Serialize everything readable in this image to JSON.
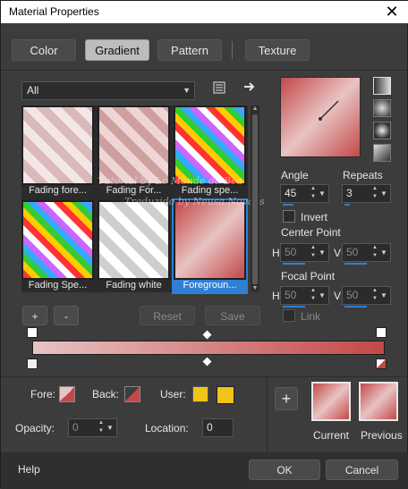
{
  "window": {
    "title": "Material Properties",
    "close_glyph": "✕"
  },
  "tabs": [
    {
      "label": "Color",
      "active": false
    },
    {
      "label": "Gradient",
      "active": true
    },
    {
      "label": "Pattern",
      "active": false
    },
    {
      "label": "Texture",
      "active": false
    }
  ],
  "filter": {
    "selected": "All"
  },
  "swatches": [
    {
      "label": "Fading fore...",
      "kind": "fading-pink-light"
    },
    {
      "label": "Fading For...",
      "kind": "fading-pink"
    },
    {
      "label": "Fading spe...",
      "kind": "rainbow"
    },
    {
      "label": "Fading Spe...",
      "kind": "rainbow"
    },
    {
      "label": "Fading white",
      "kind": "fading-white"
    },
    {
      "label": "Foregroun...",
      "kind": "fg-bg",
      "selected": true
    }
  ],
  "list_buttons": {
    "add": "+",
    "remove": "-",
    "reset": "Reset",
    "save": "Save"
  },
  "angle": {
    "label": "Angle",
    "value": "45"
  },
  "repeats": {
    "label": "Repeats",
    "value": "3"
  },
  "invert": {
    "label": "Invert",
    "checked": false
  },
  "center_point": {
    "label": "Center Point",
    "h_label": "H",
    "h_value": "50",
    "v_label": "V",
    "v_value": "50"
  },
  "focal_point": {
    "label": "Focal Point",
    "h_label": "H",
    "h_value": "50",
    "v_label": "V",
    "v_value": "50"
  },
  "link": {
    "label": "Link",
    "checked": false
  },
  "bottom": {
    "fore_label": "Fore:",
    "back_label": "Back:",
    "user_label": "User:",
    "opacity_label": "Opacity:",
    "opacity_value": "0",
    "location_label": "Location:",
    "location_value": "0"
  },
  "stack": {
    "add": "+",
    "current_label": "Current",
    "previous_label": "Previous"
  },
  "footer": {
    "help": "Help",
    "ok": "OK",
    "cancel": "Cancel"
  },
  "watermark": {
    "line1": "Tutorial by Le Monde de Bea",
    "line2": "Traduzido by Neusa Novaes"
  },
  "colors": {
    "accent": "#2f7fd6",
    "grad_start": "#e8c3c3",
    "grad_end": "#c44848",
    "user_yellow": "#f0c419"
  }
}
